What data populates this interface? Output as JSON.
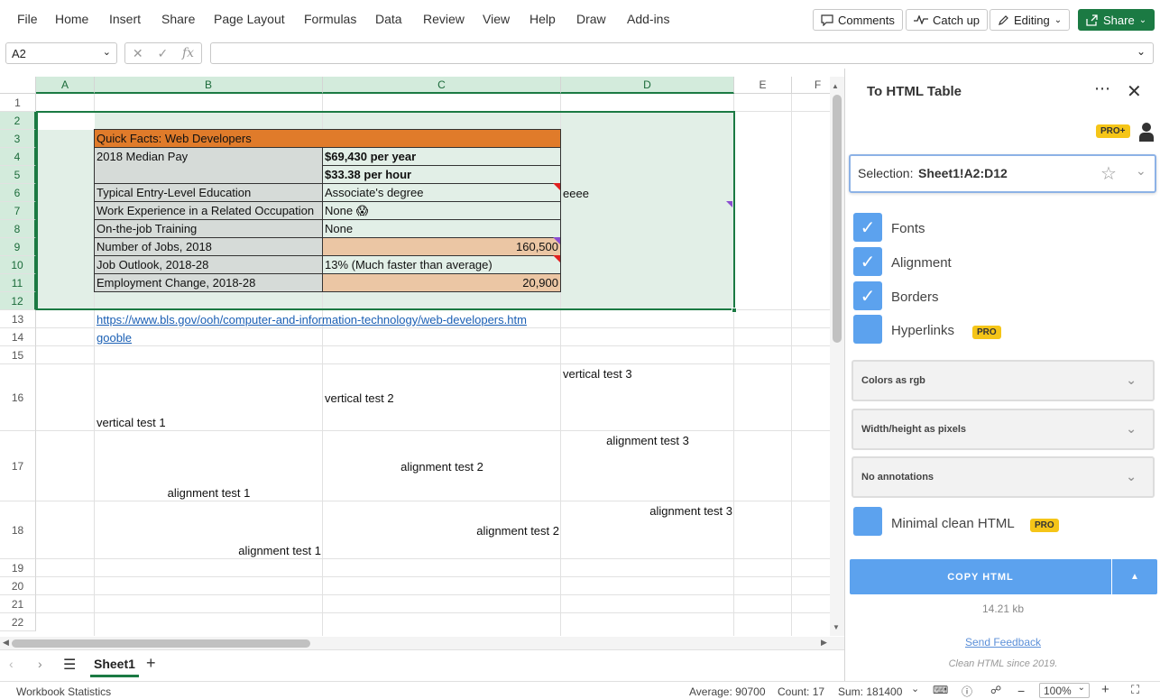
{
  "ribbon": {
    "menu": [
      "File",
      "Home",
      "Insert",
      "Share",
      "Page Layout",
      "Formulas",
      "Data",
      "Review",
      "View",
      "Help",
      "Draw",
      "Add-ins"
    ],
    "comments_label": "Comments",
    "catchup_label": "Catch up",
    "editing_label": "Editing",
    "share_label": "Share"
  },
  "formula_bar": {
    "name_box": "A2",
    "formula": ""
  },
  "columns": [
    "A",
    "B",
    "C",
    "D",
    "E",
    "F"
  ],
  "rows": [
    "1",
    "2",
    "3",
    "4",
    "5",
    "6",
    "7",
    "8",
    "9",
    "10",
    "11",
    "12",
    "13",
    "14",
    "15",
    "16",
    "17",
    "18",
    "19",
    "20",
    "21",
    "22"
  ],
  "cells": {
    "b3": "Quick Facts: Web Developers",
    "b4": "2018 Median Pay",
    "c4": "$69,430 per year",
    "c5": "$33.38 per hour",
    "b6": "Typical Entry-Level Education",
    "c6": "Associate's degree",
    "d6": "eeee",
    "b7": "Work Experience in a Related Occupation",
    "c7": "None 😱",
    "b8": "On-the-job Training",
    "c8": "None",
    "b9": "Number of Jobs, 2018",
    "c9": "160,500",
    "b10": "Job Outlook, 2018-28",
    "c10": "13% (Much faster than average)",
    "b11": "Employment Change, 2018-28",
    "c11": "20,900",
    "b13": "https://www.bls.gov/ooh/computer-and-information-technology/web-developers.htm",
    "b14": "gooble",
    "b16": "vertical test 1",
    "c16": "vertical test 2",
    "d16": "vertical test 3",
    "b17": "alignment test 1",
    "c17": "alignment test 2",
    "d17": "alignment test 3",
    "b18": "alignment test 1",
    "c18": "alignment test 2",
    "d18": "alignment test 3"
  },
  "sheet_tabs": {
    "active": "Sheet1"
  },
  "status": {
    "left": "Workbook Statistics",
    "average": "Average: 90700",
    "count": "Count: 17",
    "sum": "Sum: 181400",
    "zoom": "100%"
  },
  "pane": {
    "title": "To HTML Table",
    "pro_plus": "PRO+",
    "selection_label": "Selection:",
    "selection_value": "Sheet1!A2:D12",
    "options": [
      {
        "label": "Fonts",
        "checked": true
      },
      {
        "label": "Alignment",
        "checked": true
      },
      {
        "label": "Borders",
        "checked": true
      },
      {
        "label": "Hyperlinks",
        "checked": false,
        "pro": "PRO"
      }
    ],
    "dropdowns": [
      "Colors as rgb",
      "Width/height as pixels",
      "No annotations"
    ],
    "minimal_label": "Minimal clean HTML",
    "minimal_pro": "PRO",
    "copy_label": "COPY HTML",
    "size": "14.21 kb",
    "feedback": "Send Feedback",
    "tagline": "Clean HTML since 2019."
  },
  "colors": {
    "accent_green": "#1b7a43",
    "header_orange": "#e07b2a",
    "label_gray": "#d6dbd8",
    "value_peach": "#ebc6a4",
    "pane_blue": "#5ca2ee",
    "pro_yellow": "#f5c518"
  }
}
